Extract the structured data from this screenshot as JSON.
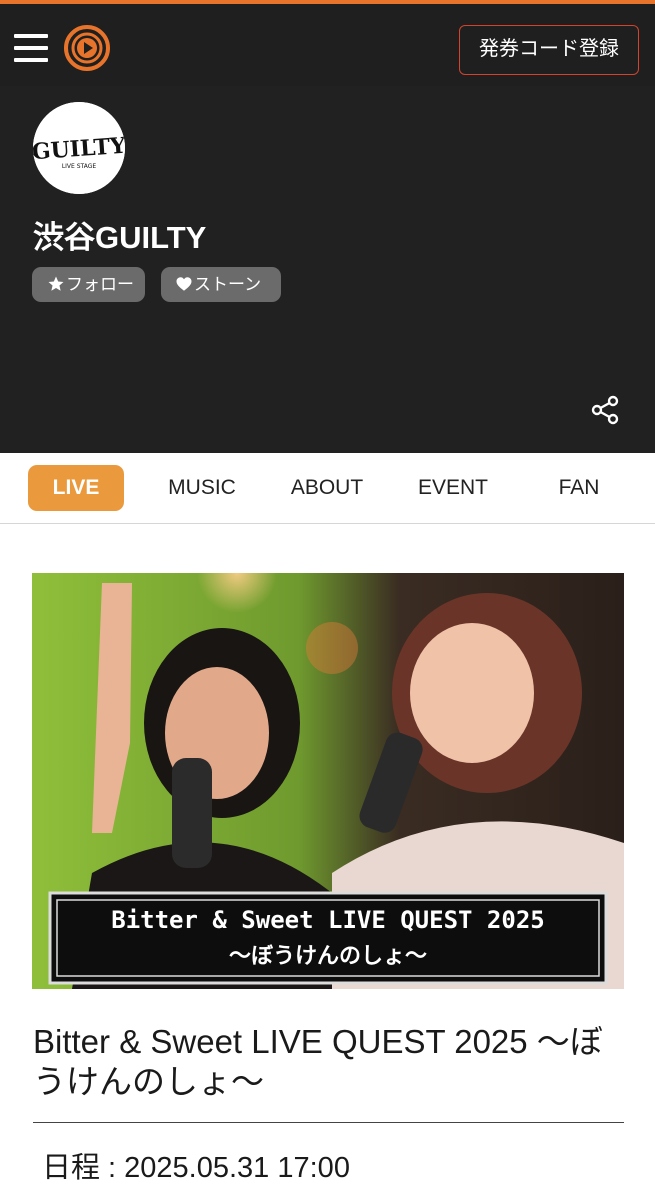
{
  "header": {
    "menu_icon": "hamburger-menu-icon",
    "logo_icon": "play-logo-icon",
    "register_button": "発券コード登録",
    "accent_color": "#e8742b"
  },
  "venue": {
    "logo_text": "GUILTY",
    "logo_subtext": "LIVE STAGE",
    "name": "渋谷GUILTY",
    "follow_label": "フォロー",
    "stone_label": "ストーン",
    "share_icon": "share-icon"
  },
  "tabs": [
    {
      "label": "LIVE",
      "active": true
    },
    {
      "label": "MUSIC",
      "active": false
    },
    {
      "label": "ABOUT",
      "active": false
    },
    {
      "label": "EVENT",
      "active": false
    },
    {
      "label": "FAN",
      "active": false
    }
  ],
  "event": {
    "banner_line1": "Bitter & Sweet LIVE QUEST 2025",
    "banner_line2": "〜ぼうけんのしょ〜",
    "title": "Bitter & Sweet LIVE QUEST 2025 〜ぼうけんのしょ〜",
    "schedule": "日程 : 2025.05.31 17:00"
  }
}
